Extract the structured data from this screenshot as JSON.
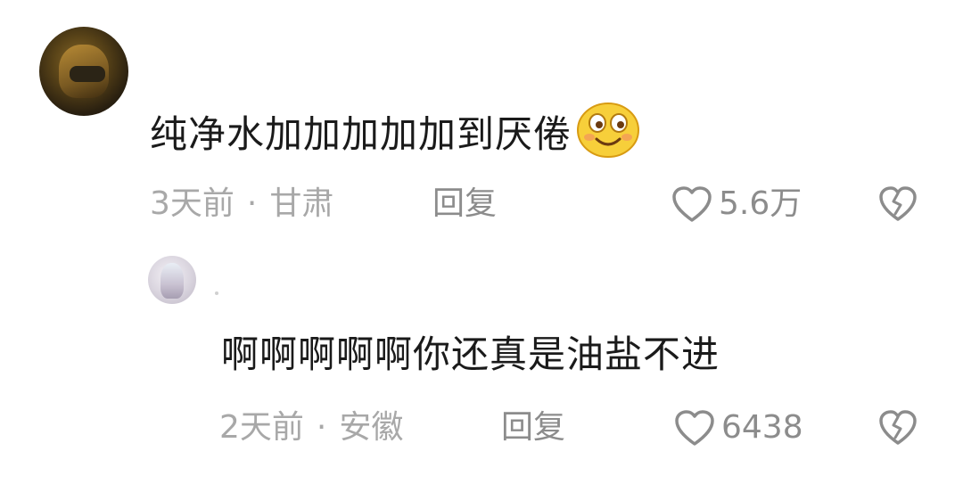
{
  "comments": [
    {
      "text": "纯净水加加加加加到厌倦",
      "emoji": "smiling-face-emoji",
      "time": "3天前",
      "separator": "·",
      "location": "甘肃",
      "reply_label": "回复",
      "likes": "5.6万"
    }
  ],
  "replies": [
    {
      "text": "啊啊啊啊啊你还真是油盐不进",
      "time": "2天前",
      "separator": "·",
      "location": "安徽",
      "reply_label": "回复",
      "likes": "6438"
    }
  ],
  "colors": {
    "text": "#1a1a1a",
    "meta": "#a8a8a8",
    "action": "#8c8c8c",
    "background": "#ffffff"
  },
  "icons": {
    "like": "heart-outline-icon",
    "dislike": "broken-heart-icon"
  }
}
